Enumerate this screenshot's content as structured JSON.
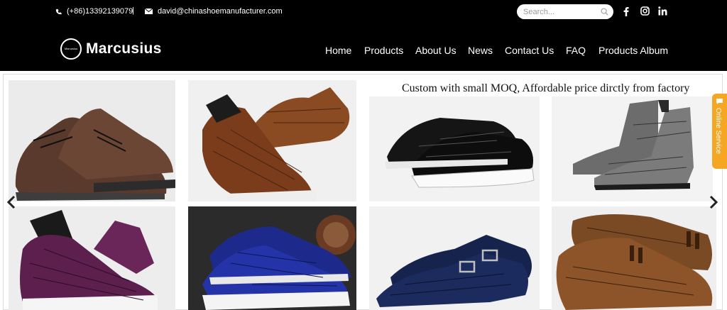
{
  "header": {
    "phone": "(+86)13392139079",
    "separator": "|",
    "email": "david@chinashoemanufacturer.com",
    "search_placeholder": "Search...",
    "social_icons": [
      "facebook-icon",
      "instagram-icon",
      "linkedin-icon"
    ]
  },
  "logo": {
    "text": "Marcusius",
    "mark_text": "Marcusius"
  },
  "nav": {
    "items": [
      "Home",
      "Products",
      "About Us",
      "News",
      "Contact Us",
      "FAQ",
      "Products Album"
    ]
  },
  "banner": {
    "tagline": "Custom with small MOQ, Affordable price dirctly from factory",
    "tiles": [
      "brown leather sneakers",
      "brown crocodile high-top sneakers",
      "black crocodile sneakers",
      "grey crocodile chelsea boots",
      "purple crocodile high-top sneakers",
      "blue crocodile sneakers",
      "navy crocodile monk strap shoes",
      "brown crocodile tassel loafers"
    ]
  },
  "side_tab": {
    "label": "Online Service"
  },
  "colors": {
    "header_bg": "#000000",
    "accent": "#f5a623",
    "text_light": "#ffffff"
  }
}
